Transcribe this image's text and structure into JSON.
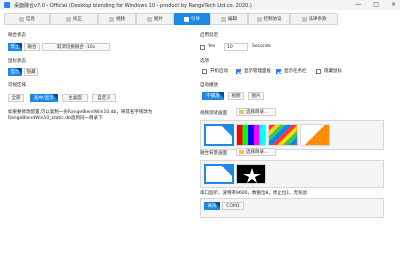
{
  "window": {
    "title": "桌面融合v7.0 - Official (Desktop blending for Windows 10 - product by RangeTech Ltd.co. 2020.)",
    "controls": [
      "—",
      "□",
      "×"
    ]
  },
  "tabs": [
    {
      "label": "信息",
      "active": false
    },
    {
      "label": "校正",
      "active": false
    },
    {
      "label": "视频",
      "active": false
    },
    {
      "label": "图片",
      "active": false
    },
    {
      "label": "引导",
      "active": true
    },
    {
      "label": "编辑",
      "active": false
    },
    {
      "label": "控制协议",
      "active": false
    },
    {
      "label": "法律条款",
      "active": false
    }
  ],
  "left": {
    "fusion_status_title": "融合状态",
    "fusion_status_buttons": [
      {
        "label": "禁止",
        "selected": true
      },
      {
        "label": "融合",
        "selected": false
      },
      {
        "label": "取消切换融合 -10s",
        "selected": false
      }
    ],
    "hide_status_title": "鼠标状态",
    "hide_status_buttons": [
      {
        "label": "显示",
        "selected": true
      },
      {
        "label": "隐藏",
        "selected": false
      }
    ],
    "visible_area_title": "可视区域",
    "visible_area_buttons": [
      {
        "label": "全部",
        "selected": false
      },
      {
        "label": "居中/显示",
        "selected": true
      },
      {
        "label": "主桌面",
        "selected": false
      },
      {
        "label": "自定义",
        "selected": false
      }
    ],
    "note": "如果要修改配置,可以复制一份RangeBlendWin10.db，将其名字修改为RangeBlendWin10_static.db放到同一目录下"
  },
  "right": {
    "delay_title": "启用延迟",
    "delay_yes_label": "Yes",
    "delay_value": "10",
    "delay_unit": "Seconds",
    "options_title": "选项",
    "options": [
      {
        "label": "开机启动",
        "checked": false
      },
      {
        "label": "显示管理面板",
        "checked": true
      },
      {
        "label": "显示任务栏",
        "checked": true
      },
      {
        "label": "隐藏鼠标",
        "checked": false
      }
    ],
    "autoplay_title": "自动播放",
    "autoplay_buttons": [
      {
        "label": "不播放",
        "selected": true
      },
      {
        "label": "视频",
        "selected": false
      },
      {
        "label": "图片",
        "selected": false
      }
    ],
    "test_pattern_title": "视频测试画面",
    "choose_dir_1": "选择目录...",
    "fusion_bg_title": "融合背景画面",
    "choose_dir_2": "选择目录...",
    "serial_text": "串口监听，波特率9600，数据位8，停止位1，无校验",
    "serial_buttons": [
      {
        "label": "关闭",
        "selected": true
      },
      {
        "label": "COM1",
        "selected": false
      }
    ]
  },
  "colors": {
    "accent": "#1e88e5"
  }
}
